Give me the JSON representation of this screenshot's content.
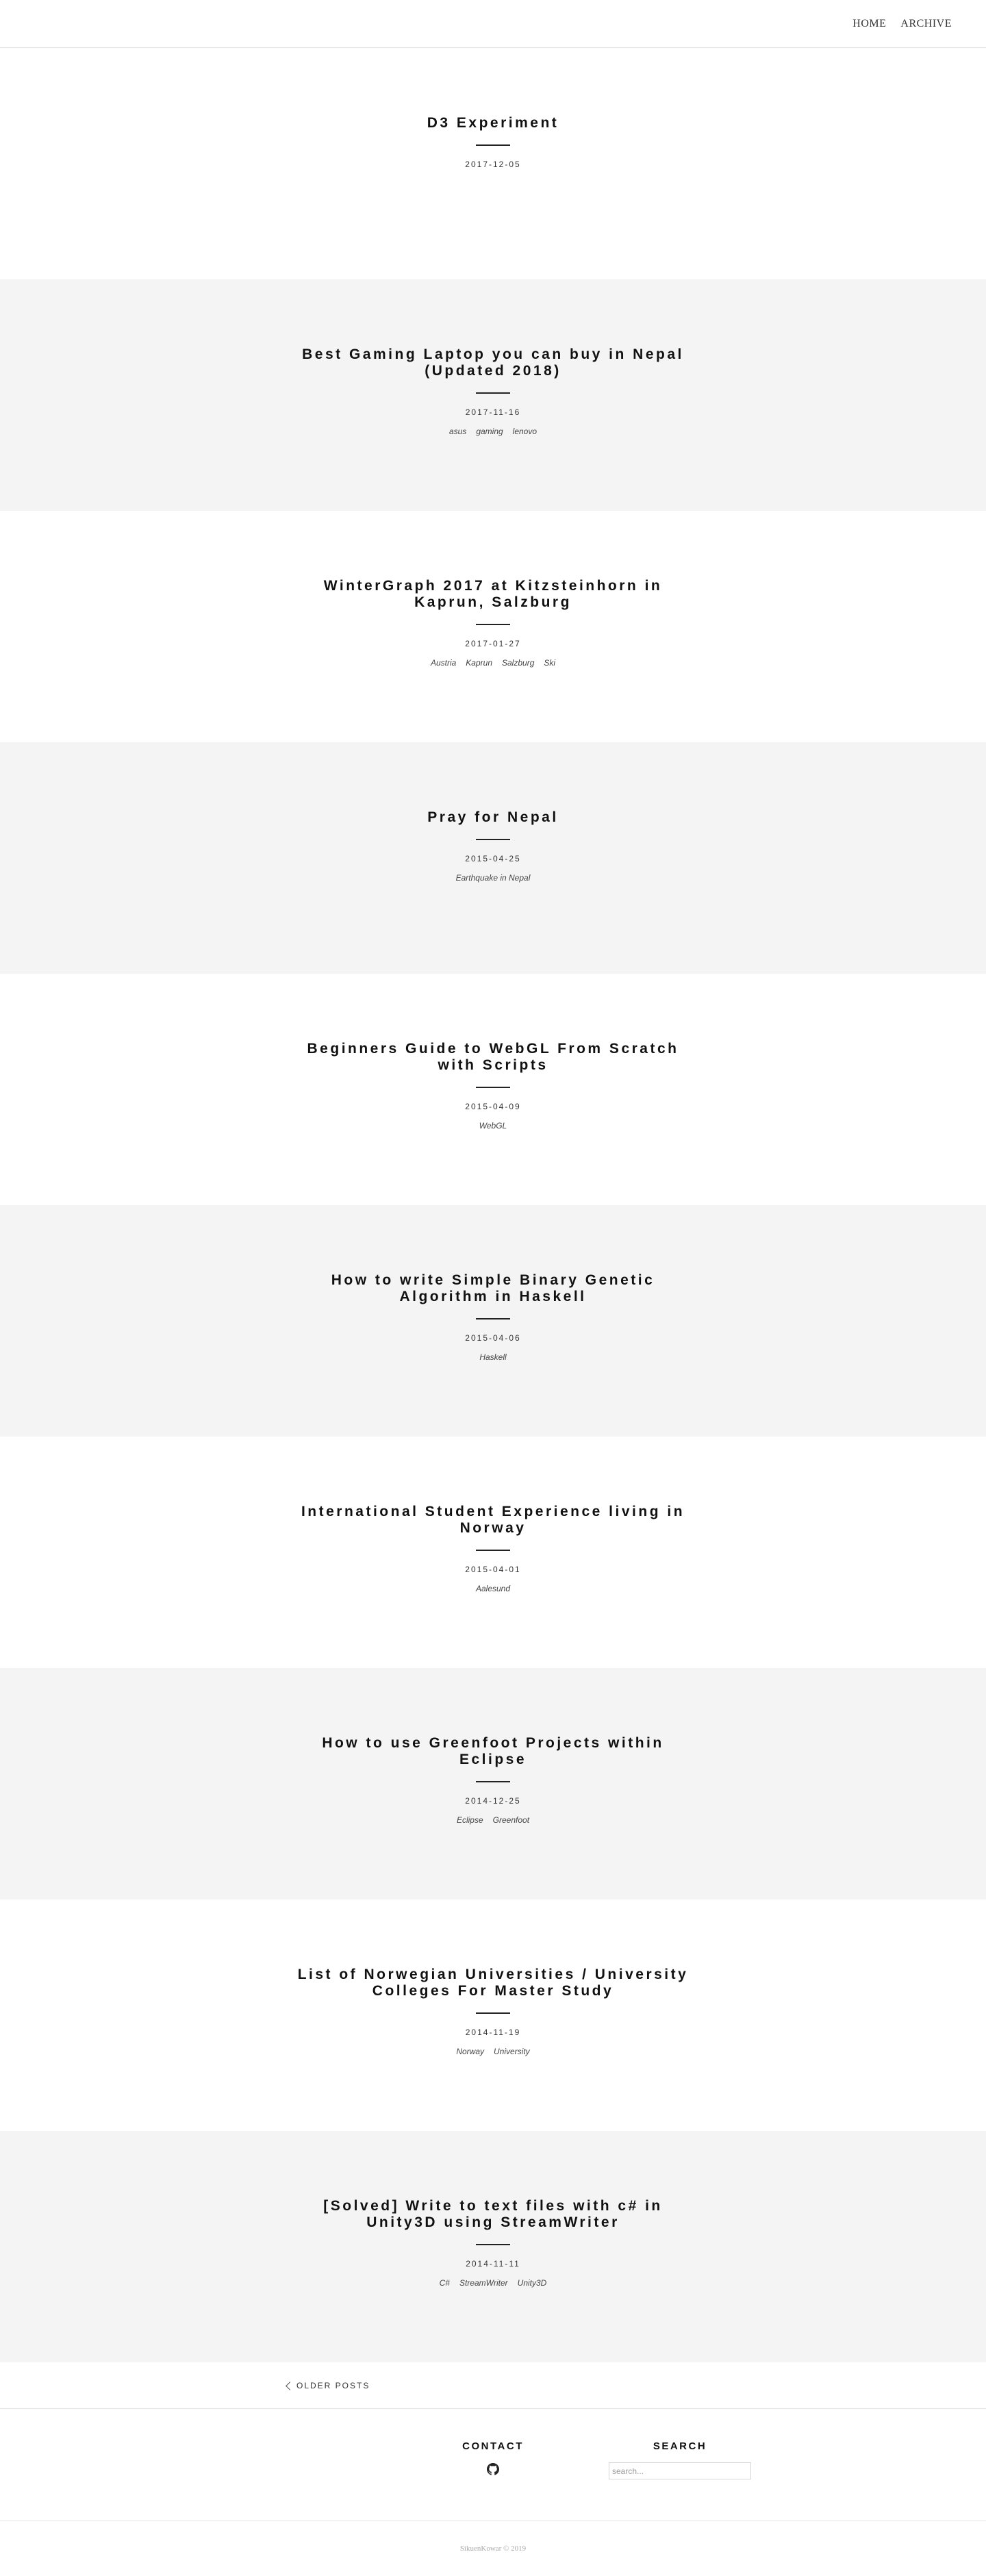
{
  "nav": {
    "home": "HOME",
    "archive": "ARCHIVE"
  },
  "posts": [
    {
      "title": "D3 Experiment",
      "date": "2017-12-05",
      "tags": []
    },
    {
      "title": "Best Gaming Laptop you can buy in Nepal (Updated 2018)",
      "date": "2017-11-16",
      "tags": [
        "asus",
        "gaming",
        "lenovo"
      ]
    },
    {
      "title": "WinterGraph 2017 at Kitzsteinhorn in Kaprun, Salzburg",
      "date": "2017-01-27",
      "tags": [
        "Austria",
        "Kaprun",
        "Salzburg",
        "Ski"
      ]
    },
    {
      "title": "Pray for Nepal",
      "date": "2015-04-25",
      "tags": [
        "Earthquake in Nepal"
      ]
    },
    {
      "title": "Beginners Guide to WebGL From Scratch with Scripts",
      "date": "2015-04-09",
      "tags": [
        "WebGL"
      ]
    },
    {
      "title": "How to write Simple Binary Genetic Algorithm in Haskell",
      "date": "2015-04-06",
      "tags": [
        "Haskell"
      ]
    },
    {
      "title": "International Student Experience living in Norway",
      "date": "2015-04-01",
      "tags": [
        "Aalesund"
      ]
    },
    {
      "title": "How to use Greenfoot Projects within Eclipse",
      "date": "2014-12-25",
      "tags": [
        "Eclipse",
        "Greenfoot"
      ]
    },
    {
      "title": "List of Norwegian Universities / University Colleges For Master Study",
      "date": "2014-11-19",
      "tags": [
        "Norway",
        "University"
      ]
    },
    {
      "title": "[Solved] Write to text files with c# in Unity3D using StreamWriter",
      "date": "2014-11-11",
      "tags": [
        "C#",
        "StreamWriter",
        "Unity3D"
      ]
    }
  ],
  "pager": {
    "older_label": "OLDER POSTS"
  },
  "footer": {
    "contact_heading": "CONTACT",
    "github_icon": "github-icon",
    "search_heading": "SEARCH",
    "search_placeholder": "search...",
    "copyright": "SikuenKowar © 2019"
  },
  "colors": {
    "alt_row_background": "#f4f4f4",
    "text": "#111111",
    "rule": "#222222"
  }
}
